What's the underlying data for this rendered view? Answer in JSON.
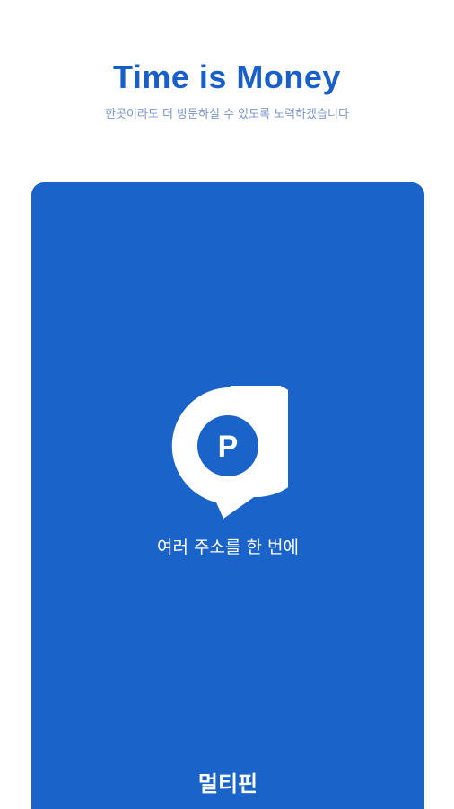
{
  "header": {
    "title": "Time is Money",
    "subtitle": "한곳이라도 더 방문하실 수 있도록 노력하겠습니다"
  },
  "card": {
    "pin_letter": "P",
    "caption": "여러 주소를 한 번에",
    "brand": "멀티핀"
  },
  "colors": {
    "accent": "#1a63c9",
    "title": "#1a5fc9",
    "subtitle": "#7a96c9"
  }
}
